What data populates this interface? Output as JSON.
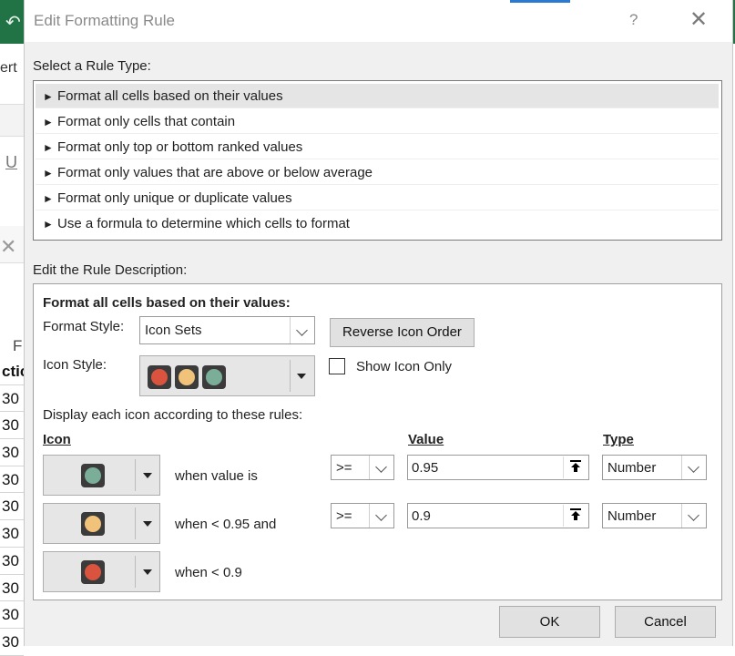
{
  "background": {
    "menu_fragment": "ert",
    "underline_fragment": "U",
    "column_letter": "F",
    "cells": [
      "ctic",
      "30",
      "30",
      "30",
      "30",
      "30",
      "30",
      "30",
      "30",
      "30",
      "30"
    ]
  },
  "dialog": {
    "title": "Edit Formatting Rule",
    "help_glyph": "?",
    "close_glyph": "✕"
  },
  "rule_type": {
    "label": "Select a Rule Type:",
    "items": [
      "Format all cells based on their values",
      "Format only cells that contain",
      "Format only top or bottom ranked values",
      "Format only values that are above or below average",
      "Format only unique or duplicate values",
      "Use a formula to determine which cells to format"
    ],
    "selected_index": 0
  },
  "description": {
    "label": "Edit the Rule Description:",
    "heading": "Format all cells based on their values:",
    "format_style_label": "Format Style:",
    "format_style_value": "Icon Sets",
    "reverse_button": "Reverse Icon Order",
    "icon_style_label": "Icon Style:",
    "show_icon_only_label": "Show Icon Only",
    "show_icon_only_checked": false,
    "display_rules_label": "Display each icon according to these rules:",
    "col_icon": "Icon",
    "col_value": "Value",
    "col_type": "Type",
    "rules": [
      {
        "icon": "green-light-icon",
        "condition": "when value is",
        "operator": ">=",
        "value": "0.95",
        "type": "Number"
      },
      {
        "icon": "yellow-light-icon",
        "condition": "when < 0.95 and",
        "operator": ">=",
        "value": "0.9",
        "type": "Number"
      },
      {
        "icon": "red-light-icon",
        "condition": "when < 0.9"
      }
    ]
  },
  "buttons": {
    "ok": "OK",
    "cancel": "Cancel"
  },
  "colors": {
    "red_light": "#d9533f",
    "yellow_light": "#f0c27a",
    "green_light": "#7aae98",
    "excel_green": "#217346"
  }
}
